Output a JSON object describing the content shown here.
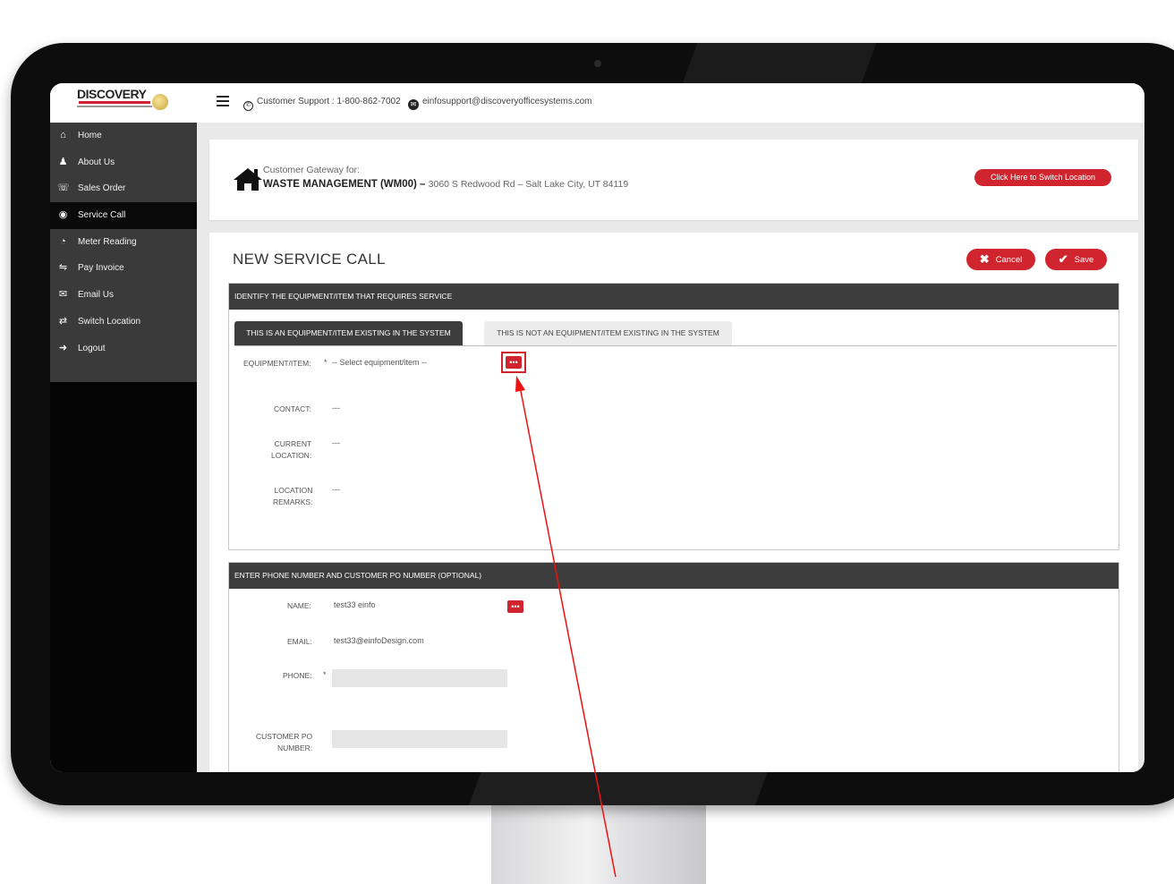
{
  "app": {
    "logo_text": "DISCOVERY",
    "support_label": "Customer Support : 1-800-862-7002",
    "email": "einfosupport@discoveryofficesystems.com"
  },
  "sidebar": {
    "items": [
      {
        "label": "Home",
        "icon": "home-icon",
        "active": false
      },
      {
        "label": "About Us",
        "icon": "user-icon",
        "active": false
      },
      {
        "label": "Sales Order",
        "icon": "sales-order-icon",
        "active": false
      },
      {
        "label": "Service Call",
        "icon": "service-call-icon",
        "active": true
      },
      {
        "label": "Meter Reading",
        "icon": "meter-icon",
        "active": false
      },
      {
        "label": "Pay Invoice",
        "icon": "handshake-icon",
        "active": false
      },
      {
        "label": "Email Us",
        "icon": "envelope-icon",
        "active": false
      },
      {
        "label": "Switch Location",
        "icon": "switch-location-icon",
        "active": false
      },
      {
        "label": "Logout",
        "icon": "logout-icon",
        "active": false
      }
    ]
  },
  "gateway": {
    "label": "Customer Gateway for:",
    "customer": "WASTE MANAGEMENT (WM00) –",
    "address": "3060 S Redwood Rd – Salt Lake City, UT 84119",
    "switch_button": "Click Here to Switch Location"
  },
  "page": {
    "title": "NEW SERVICE CALL",
    "cancel": "Cancel",
    "save": "Save"
  },
  "section_equipment": {
    "heading": "IDENTIFY THE EQUIPMENT/ITEM THAT REQUIRES SERVICE",
    "tab_existing": "THIS IS AN EQUIPMENT/ITEM EXISTING IN THE SYSTEM",
    "tab_not_existing": "THIS IS NOT AN EQUIPMENT/ITEM EXISTING IN THE SYSTEM",
    "equipment_label": "EQUIPMENT/ITEM:",
    "required_mark": "*",
    "equipment_value": "-- Select equipment/item --",
    "dots": "•••",
    "contact_label": "CONTACT:",
    "contact_value": "---",
    "current_location_label_1": "CURRENT",
    "current_location_label_2": "LOCATION:",
    "current_location_value": "---",
    "location_remarks_label_1": "LOCATION",
    "location_remarks_label_2": "REMARKS:",
    "location_remarks_value": "---"
  },
  "section_phone": {
    "heading": "ENTER PHONE NUMBER AND CUSTOMER PO NUMBER (OPTIONAL)",
    "name_label": "NAME:",
    "name_value": "test33 einfo",
    "dots": "•••",
    "email_label": "EMAIL:",
    "email_value": "test33@einfoDesign.com",
    "phone_label": "PHONE:",
    "required_mark": "*",
    "phone_value": "",
    "po_label_1": "CUSTOMER PO",
    "po_label_2": "NUMBER:",
    "po_value": ""
  },
  "colors": {
    "accent_red": "#d0252e",
    "sidebar_bg": "#3a3a3a",
    "section_head": "#3d3d3d"
  }
}
